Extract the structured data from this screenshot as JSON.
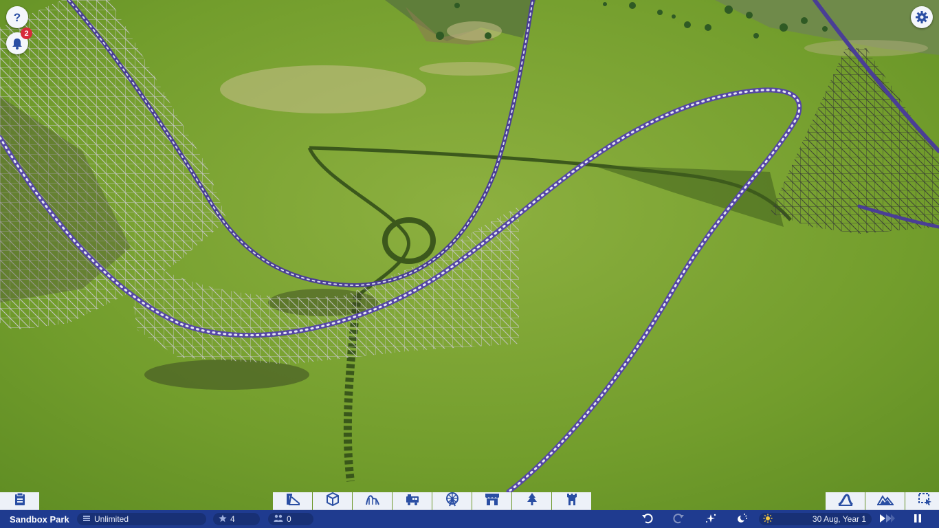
{
  "top_left": {
    "help_icon": "help-icon",
    "notifications": {
      "icon": "bell-icon",
      "count": "2"
    }
  },
  "top_right": {
    "settings_icon": "gear-icon"
  },
  "toolbar": {
    "left": [
      {
        "name": "park-management-button",
        "icon": "clipboard-icon"
      }
    ],
    "center": [
      {
        "name": "build-paths-button",
        "icon": "path-build-icon"
      },
      {
        "name": "build-objects-button",
        "icon": "cube-icon"
      },
      {
        "name": "coasters-button",
        "icon": "coaster-icon"
      },
      {
        "name": "transport-rides-button",
        "icon": "train-icon"
      },
      {
        "name": "flat-rides-button",
        "icon": "ferris-wheel-icon"
      },
      {
        "name": "shops-button",
        "icon": "shop-icon"
      },
      {
        "name": "scenery-button",
        "icon": "tree-icon"
      },
      {
        "name": "themed-buildings-button",
        "icon": "tower-icon"
      }
    ],
    "right": [
      {
        "name": "track-editor-button",
        "icon": "track-icon"
      },
      {
        "name": "terrain-button",
        "icon": "mountain-icon"
      },
      {
        "name": "select-area-button",
        "icon": "select-box-icon"
      }
    ]
  },
  "status_bar": {
    "park_name": "Sandbox Park",
    "money": "Unlimited",
    "rating": "4",
    "guests": "0",
    "date": "30 Aug, Year 1",
    "icons": {
      "money": "coins-icon",
      "rating": "star-icon",
      "guests": "guests-icon",
      "undo": "undo-icon",
      "redo": "redo-icon",
      "sparkle": "sparkle-icon",
      "day_night": "day-night-icon",
      "weather": "sun-icon",
      "speed": "fast-forward-icon",
      "pause": "pause-icon"
    }
  },
  "colors": {
    "grass": "#6f9a2a",
    "status_bar": "#1f3b8f",
    "toolbar_button": "#edf1f8",
    "icon_blue": "#2a4ea3",
    "badge": "#d82a3a",
    "track_purple": "#5b4aa8"
  }
}
